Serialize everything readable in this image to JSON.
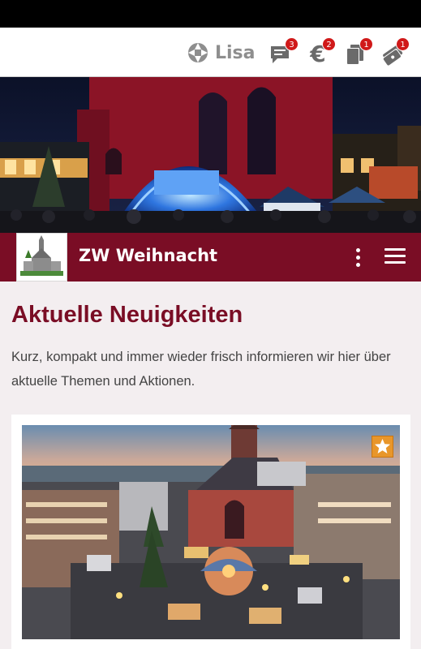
{
  "topbar": {
    "user_name": "Lisa",
    "icons": [
      {
        "name": "chat-icon",
        "badge": "3"
      },
      {
        "name": "euro-icon",
        "glyph": "€",
        "badge": "2"
      },
      {
        "name": "documents-icon",
        "badge": "1"
      },
      {
        "name": "tickets-icon",
        "badge": "1"
      }
    ]
  },
  "app": {
    "title": "ZW Weihnacht"
  },
  "content": {
    "heading": "Aktuelle Neuigkeiten",
    "intro": "Kurz, kompakt und immer wieder frisch informieren wir hier über aktuelle Themen und Aktionen."
  },
  "colors": {
    "brand": "#7a0d25",
    "badge": "#d01919",
    "star": "#e8962a"
  }
}
